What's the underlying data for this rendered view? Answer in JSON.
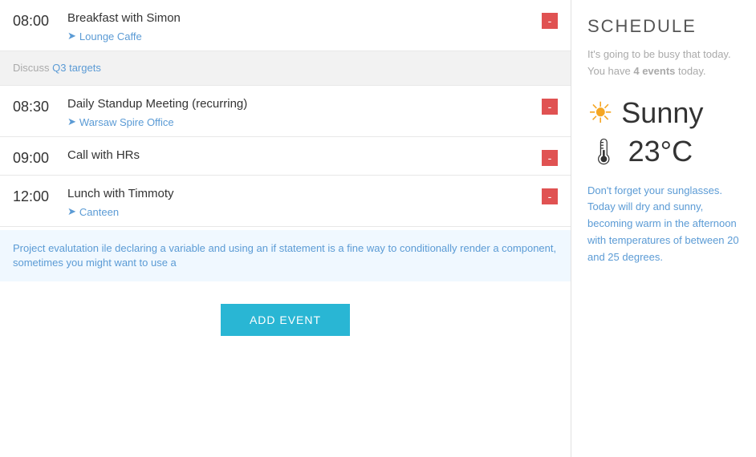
{
  "schedule": {
    "title": "SCHEDULE",
    "subtitle_before": "It's going to be busy that today. You have ",
    "event_count": "4 events",
    "subtitle_after": " today.",
    "weather": {
      "condition": "Sunny",
      "temperature": "23°C",
      "description": "Don't forget your sunglasses. Today will dry and sunny, becoming warm in the afternoon with temperatures of between 20 and 25 degrees."
    }
  },
  "events": [
    {
      "time": "08:00",
      "title": "Breakfast with Simon",
      "location": "Lounge Caffe",
      "has_note": true,
      "note": "Discuss Q3 targets",
      "note_highlight": "Q3 targets"
    },
    {
      "time": "08:30",
      "title": "Daily Standup Meeting (recurring)",
      "location": "Warsaw Spire Office",
      "has_note": false
    },
    {
      "time": "09:00",
      "title": "Call with HRs",
      "location": "",
      "has_note": false
    },
    {
      "time": "12:00",
      "title": "Lunch with Timmoty",
      "location": "Canteen",
      "has_note": true,
      "note_blue": "Project evalutation ile declaring a variable and using an if statement is a fine way to conditionally render a component, sometimes you might want to use a"
    }
  ],
  "add_event_label": "ADD EVENT",
  "note_prefix": "Discuss ",
  "note_suffix": "Q3 targets"
}
